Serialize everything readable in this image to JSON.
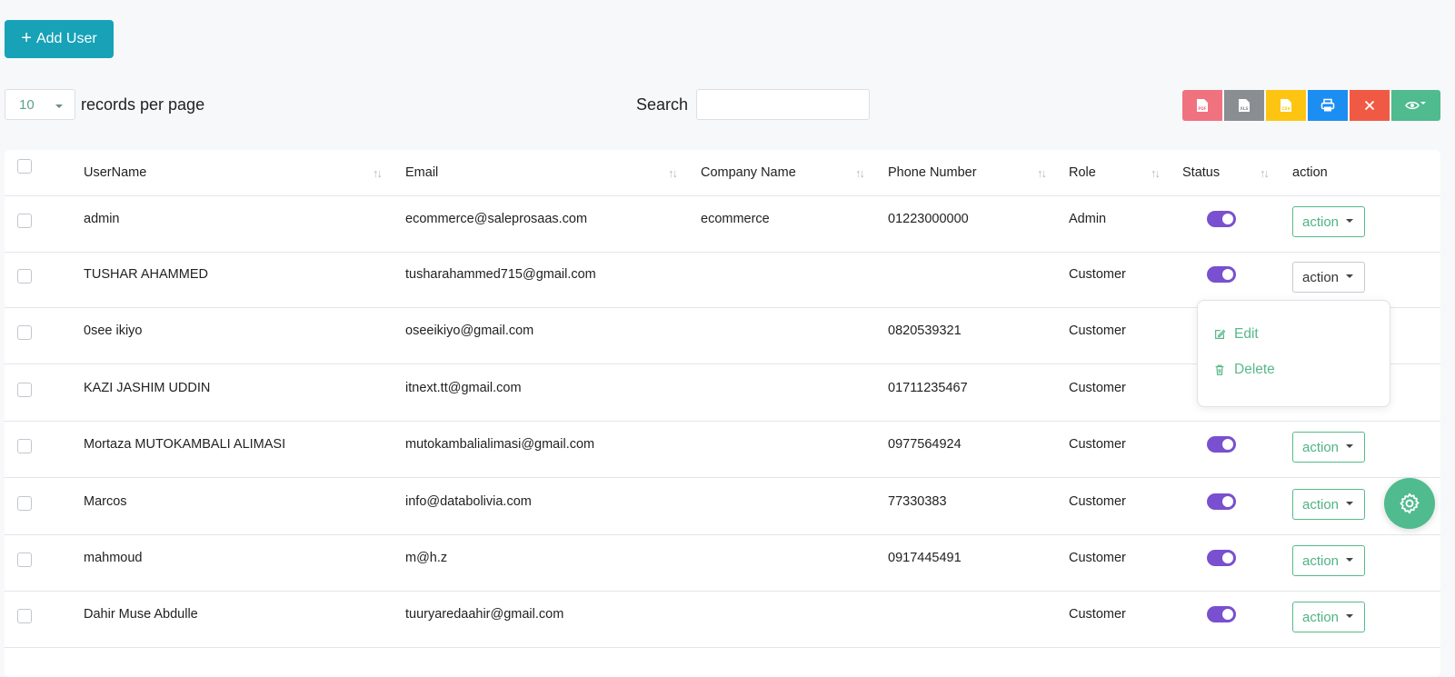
{
  "toolbar": {
    "add_user_label": "Add User"
  },
  "pagination": {
    "per_page_value": "10",
    "per_page_label": "records per page"
  },
  "search": {
    "label": "Search",
    "value": ""
  },
  "export_buttons": [
    {
      "name": "pdf",
      "color": "#f0727f",
      "glyph": "PDF"
    },
    {
      "name": "xls",
      "color": "#8a8d91",
      "glyph": "XLS"
    },
    {
      "name": "csv",
      "color": "#fdc512",
      "glyph": "CSV"
    },
    {
      "name": "print",
      "color": "#1c8ef2",
      "glyph": "print"
    },
    {
      "name": "close",
      "color": "#f05a44",
      "glyph": "close"
    },
    {
      "name": "column-visibility",
      "color": "#4fbb8e",
      "glyph": "eye"
    }
  ],
  "table": {
    "columns": [
      "UserName",
      "Email",
      "Company Name",
      "Phone Number",
      "Role",
      "Status",
      "action"
    ],
    "rows": [
      {
        "username": "admin",
        "email": "ecommerce@saleprosaas.com",
        "company": "ecommerce",
        "phone": "01223000000",
        "role": "Admin",
        "status_on": true,
        "action_label": "action"
      },
      {
        "username": "TUSHAR AHAMMED",
        "email": "tusharahammed715@gmail.com",
        "company": "",
        "phone": "",
        "role": "Customer",
        "status_on": true,
        "action_label": "action"
      },
      {
        "username": "0see ikiyo",
        "email": "oseeikiyo@gmail.com",
        "company": "",
        "phone": "0820539321",
        "role": "Customer",
        "status_on": true,
        "action_label": "action"
      },
      {
        "username": "KAZI JASHIM UDDIN",
        "email": "itnext.tt@gmail.com",
        "company": "",
        "phone": "01711235467",
        "role": "Customer",
        "status_on": true,
        "action_label": "action"
      },
      {
        "username": "Mortaza MUTOKAMBALI ALIMASI",
        "email": "mutokambalialimasi@gmail.com",
        "company": "",
        "phone": "0977564924",
        "role": "Customer",
        "status_on": true,
        "action_label": "action"
      },
      {
        "username": "Marcos",
        "email": "info@databolivia.com",
        "company": "",
        "phone": "77330383",
        "role": "Customer",
        "status_on": true,
        "action_label": "action"
      },
      {
        "username": "mahmoud",
        "email": "m@h.z",
        "company": "",
        "phone": "0917445491",
        "role": "Customer",
        "status_on": true,
        "action_label": "action"
      },
      {
        "username": "Dahir Muse Abdulle",
        "email": "tuuryaredaahir@gmail.com",
        "company": "",
        "phone": "",
        "role": "Customer",
        "status_on": true,
        "action_label": "action"
      }
    ]
  },
  "action_menu": {
    "edit_label": "Edit",
    "delete_label": "Delete"
  },
  "colors": {
    "accent": "#17a2b8",
    "toggle": "#7950cf",
    "green": "#4fbb8e"
  }
}
